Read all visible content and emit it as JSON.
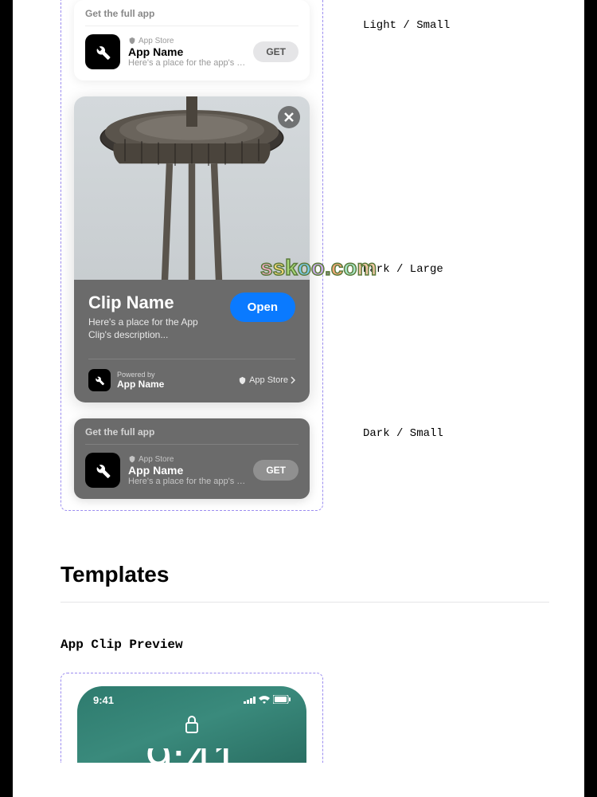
{
  "labels": {
    "light_small": "Light / Small",
    "dark_large": "Dark / Large",
    "dark_small": "Dark / Small"
  },
  "light_small": {
    "header": "Get the full app",
    "store": "App Store",
    "app_name": "App Name",
    "description": "Here's a place for the app's desc...",
    "get": "GET"
  },
  "dark_large": {
    "clip_name": "Clip Name",
    "clip_desc": "Here's a place for the App Clip's description...",
    "open": "Open",
    "powered_by": "Powered by",
    "app_name": "App Name",
    "store": "App Store"
  },
  "dark_small": {
    "header": "Get the full app",
    "store": "App Store",
    "app_name": "App Name",
    "description": "Here's a place for the app's desc...",
    "get": "GET"
  },
  "sections": {
    "templates": "Templates",
    "app_clip_preview": "App Clip Preview"
  },
  "phone": {
    "time": "9:41"
  },
  "watermark": "sskoo.com"
}
